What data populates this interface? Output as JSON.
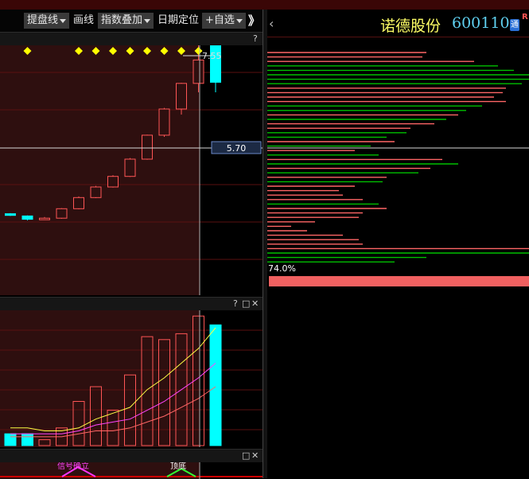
{
  "toolbar": {
    "overlay_dropdown": "提盘线",
    "draw_label": "画线",
    "index_overlay": "指数叠加",
    "date_locate": "日期定位",
    "add_watchlist": "+自选",
    "expand_icon": "》"
  },
  "main_panel": {
    "help_label": "?",
    "price_high_label": "7.55",
    "crosshair_price": "5.70"
  },
  "vol_panel": {
    "icons": [
      "?",
      "□",
      "✕"
    ]
  },
  "ind_panel": {
    "icons": [
      "□",
      "✕"
    ],
    "signal_left": "信号确立",
    "signal_right": "顶底"
  },
  "stock": {
    "name": "诺德股份",
    "code": "600110",
    "r_badge": "R",
    "tong_badge": "通"
  },
  "chip_panel": {
    "back_icon": "‹",
    "ratio_label": "74.0%"
  },
  "colors": {
    "up": "#ff5555",
    "down": "#00ffff",
    "chip_green": "#00c000",
    "chip_red": "#ff6666",
    "ma5": "#ffff44",
    "ma10": "#ff44ff",
    "ma20": "#ff6666"
  },
  "chart_data": {
    "type": "candlestick",
    "candles": [
      {
        "open": 4.52,
        "close": 4.49,
        "high": 4.53,
        "low": 4.48
      },
      {
        "open": 4.48,
        "close": 4.42,
        "high": 4.49,
        "low": 4.4
      },
      {
        "open": 4.43,
        "close": 4.44,
        "high": 4.46,
        "low": 4.41
      },
      {
        "open": 4.44,
        "close": 4.61,
        "high": 4.62,
        "low": 4.43
      },
      {
        "open": 4.61,
        "close": 4.81,
        "high": 4.83,
        "low": 4.6
      },
      {
        "open": 4.81,
        "close": 5.0,
        "high": 5.02,
        "low": 4.8
      },
      {
        "open": 5.0,
        "close": 5.19,
        "high": 5.21,
        "low": 4.99
      },
      {
        "open": 5.19,
        "close": 5.5,
        "high": 5.52,
        "low": 5.18
      },
      {
        "open": 5.5,
        "close": 5.93,
        "high": 5.94,
        "low": 5.49
      },
      {
        "open": 5.93,
        "close": 6.4,
        "high": 6.42,
        "low": 5.9
      },
      {
        "open": 6.4,
        "close": 6.86,
        "high": 6.87,
        "low": 6.3
      },
      {
        "open": 6.86,
        "close": 7.28,
        "high": 7.55,
        "low": 6.7
      },
      {
        "open": 7.55,
        "close": 6.88,
        "high": 7.55,
        "low": 6.7
      }
    ],
    "signals": [
      1,
      4,
      5,
      6,
      7,
      8,
      9,
      10,
      11
    ],
    "volume": [
      4,
      4,
      2,
      6,
      15,
      20,
      12,
      24,
      37,
      36,
      38,
      44,
      41
    ],
    "ma5": [
      6,
      6,
      5,
      5,
      6,
      9,
      11,
      13,
      19,
      23,
      28,
      33,
      40
    ],
    "ma10": [
      4,
      4,
      4,
      4,
      5,
      7,
      8,
      9,
      12,
      15,
      19,
      23,
      28
    ],
    "ma20": [
      3,
      3,
      3,
      3,
      4,
      5,
      5,
      6,
      8,
      10,
      13,
      16,
      20
    ],
    "chips": [
      {
        "w": 200,
        "c": "r"
      },
      {
        "w": 195,
        "c": "r"
      },
      {
        "w": 260,
        "c": "r"
      },
      {
        "w": 290,
        "c": "g"
      },
      {
        "w": 310,
        "c": "g"
      },
      {
        "w": 329,
        "c": "g"
      },
      {
        "w": 329,
        "c": "g"
      },
      {
        "w": 320,
        "c": "g"
      },
      {
        "w": 300,
        "c": "r"
      },
      {
        "w": 296,
        "c": "r"
      },
      {
        "w": 285,
        "c": "r"
      },
      {
        "w": 300,
        "c": "r"
      },
      {
        "w": 270,
        "c": "g"
      },
      {
        "w": 250,
        "c": "g"
      },
      {
        "w": 240,
        "c": "r"
      },
      {
        "w": 225,
        "c": "g"
      },
      {
        "w": 210,
        "c": "r"
      },
      {
        "w": 180,
        "c": "r"
      },
      {
        "w": 175,
        "c": "g"
      },
      {
        "w": 150,
        "c": "g"
      },
      {
        "w": 160,
        "c": "r"
      },
      {
        "w": 130,
        "c": "g"
      },
      {
        "w": 110,
        "c": "r"
      },
      {
        "w": 140,
        "c": "g"
      },
      {
        "w": 220,
        "c": "r"
      },
      {
        "w": 240,
        "c": "g"
      },
      {
        "w": 205,
        "c": "r"
      },
      {
        "w": 190,
        "c": "g"
      },
      {
        "w": 150,
        "c": "r"
      },
      {
        "w": 145,
        "c": "g"
      },
      {
        "w": 110,
        "c": "r"
      },
      {
        "w": 90,
        "c": "r"
      },
      {
        "w": 95,
        "c": "r"
      },
      {
        "w": 120,
        "c": "r"
      },
      {
        "w": 140,
        "c": "g"
      },
      {
        "w": 150,
        "c": "r"
      },
      {
        "w": 120,
        "c": "r"
      },
      {
        "w": 115,
        "c": "r"
      },
      {
        "w": 60,
        "c": "r"
      },
      {
        "w": 30,
        "c": "r"
      },
      {
        "w": 50,
        "c": "r"
      },
      {
        "w": 95,
        "c": "r"
      },
      {
        "w": 115,
        "c": "r"
      },
      {
        "w": 120,
        "c": "r"
      },
      {
        "w": 329,
        "c": "r"
      },
      {
        "w": 329,
        "c": "g"
      },
      {
        "w": 200,
        "c": "g"
      },
      {
        "w": 160,
        "c": "g"
      }
    ]
  }
}
